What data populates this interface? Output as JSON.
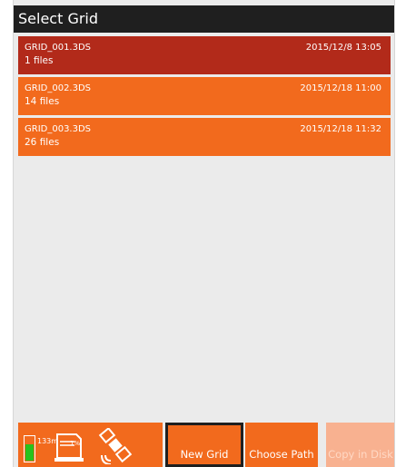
{
  "window": {
    "title": "Select Grid"
  },
  "grids": [
    {
      "name": "GRID_001.3DS",
      "count": "1 files",
      "date": "2015/12/8 13:05",
      "selected": true
    },
    {
      "name": "GRID_002.3DS",
      "count": "14 files",
      "date": "2015/12/18 11:00",
      "selected": false
    },
    {
      "name": "GRID_003.3DS",
      "count": "26 files",
      "date": "2015/12/18 11:32",
      "selected": false
    }
  ],
  "status": {
    "battery_icon": "battery-icon",
    "memory": "133m",
    "card_icon": "sd-card-icon",
    "card_usage": "1%",
    "satellite_icon": "satellite-icon"
  },
  "buttons": {
    "new_grid": "New Grid",
    "choose_path": "Choose Path",
    "copy_in_disk": "Copy in Disk"
  },
  "colors": {
    "accent": "#f26a1d",
    "selected": "#b22a1a",
    "titlebar": "#1f1f1f",
    "disabled": "#f8b190",
    "battery": "#27c21d"
  }
}
